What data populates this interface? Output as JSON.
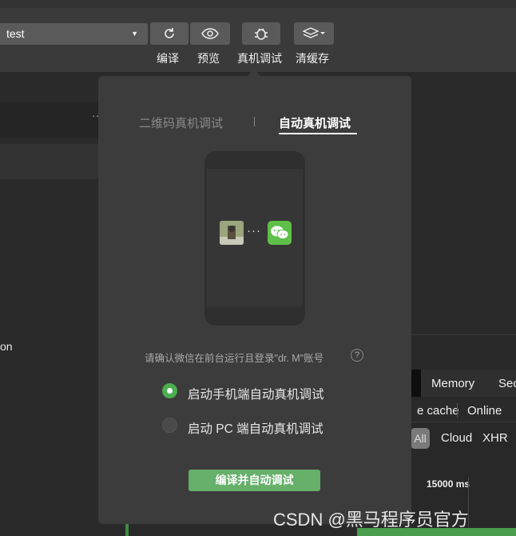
{
  "toolbar": {
    "project_name": "test",
    "buttons": [
      {
        "label": "编译",
        "icon": "refresh-icon"
      },
      {
        "label": "预览",
        "icon": "eye-icon"
      },
      {
        "label": "真机调试",
        "icon": "bug-icon"
      },
      {
        "label": "清缓存",
        "icon": "layers-icon"
      }
    ]
  },
  "background": {
    "side_text": "on",
    "devtools": {
      "tabs": [
        "Memory",
        "Sec"
      ],
      "options": [
        "e cache",
        "Online"
      ],
      "filters": [
        "All",
        "Cloud",
        "XHR"
      ],
      "timeline_label": "15000 ms"
    }
  },
  "popup": {
    "tabs": [
      "二维码真机调试",
      "自动真机调试"
    ],
    "active_tab": "自动真机调试",
    "confirm_text": "请确认微信在前台运行且登录\"dr. M\"账号",
    "help": "?",
    "options": [
      {
        "label": "启动手机端自动真机调试",
        "selected": true
      },
      {
        "label": "启动 PC 端自动真机调试",
        "selected": false
      }
    ],
    "submit_label": "编译并自动调试"
  },
  "watermark": "CSDN @黑马程序员官方",
  "colors": {
    "accent": "#4cae4f",
    "button": "#66b06a",
    "wechat": "#5fbf4a"
  }
}
